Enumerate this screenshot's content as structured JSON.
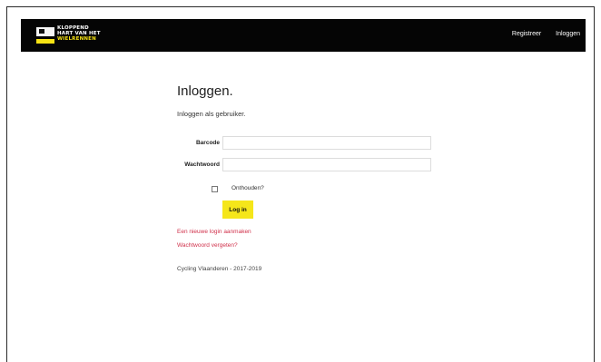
{
  "navbar": {
    "logo_lines": [
      "KLOPPEND",
      "HART VAN HET",
      "WIELRENNEN"
    ],
    "links": [
      "Registreer",
      "Inloggen"
    ]
  },
  "login": {
    "title": "Inloggen.",
    "subtitle": "Inloggen als gebruiker.",
    "barcode_label": "Barcode",
    "barcode_value": "",
    "password_label": "Wachtwoord",
    "password_value": "",
    "remember_label": "Onthouden?",
    "remember_checked": false,
    "submit_label": "Log in",
    "register_link": "Een nieuwe login aanmaken",
    "forgot_link": "Wachtwoord vergeten?"
  },
  "footer": {
    "text": "Cycling Vlaanderen - 2017-2019"
  },
  "colors": {
    "navbar_bg": "#050505",
    "accent_yellow": "#f5e61a",
    "link_red": "#d0304a"
  }
}
